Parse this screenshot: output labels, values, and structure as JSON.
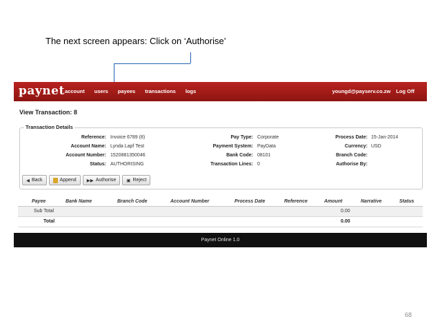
{
  "caption": "The next screen appears:  Click on ‘Authorise’",
  "app": {
    "logo": "paynet",
    "nav": [
      "account",
      "users",
      "payees",
      "transactions",
      "logs"
    ],
    "user_email": "youngd@payserv.co.zw",
    "logoff": "Log Off"
  },
  "page_title": "View Transaction: 8",
  "details": {
    "legend": "Transaction Details",
    "fields": [
      {
        "label": "Reference:",
        "value": "Invoice 6789 (8)"
      },
      {
        "label": "Account Name:",
        "value": "Lynda Lapf Test"
      },
      {
        "label": "Account Number:",
        "value": "1520881350046"
      },
      {
        "label": "Status:",
        "value": "AUTHORISING"
      },
      {
        "label": "Pay Type:",
        "value": "Corporate"
      },
      {
        "label": "Payment System:",
        "value": "PayData"
      },
      {
        "label": "Bank Code:",
        "value": "08101"
      },
      {
        "label": "Transaction Lines:",
        "value": "0"
      },
      {
        "label": "Process Date:",
        "value": "15-Jan-2014"
      },
      {
        "label": "Currency:",
        "value": "USD"
      },
      {
        "label": "Branch Code:",
        "value": ""
      },
      {
        "label": "Authorise By:",
        "value": ""
      }
    ]
  },
  "buttons": {
    "back": "Back",
    "append": "Append",
    "authorise": "Authorise",
    "reject": "Reject"
  },
  "grid": {
    "headers": [
      "Payee",
      "Bank Name",
      "Branch Code",
      "Account Number",
      "Process Date",
      "Reference",
      "Amount",
      "Narrative",
      "Status"
    ],
    "subtotal_label": "Sub Total",
    "subtotal_amount": "0.00",
    "total_label": "Total",
    "total_amount": "0.00"
  },
  "footer": "Paynet Online 1.0",
  "page_number": "68",
  "colors": {
    "topbar": "#a81e1a",
    "footer": "#111111",
    "callout": "#1f5fb0"
  }
}
